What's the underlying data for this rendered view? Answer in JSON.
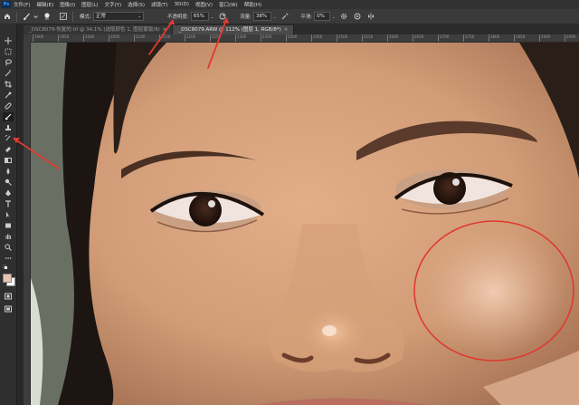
{
  "menubar": {
    "logo": "Ps",
    "items": [
      "文件(F)",
      "编辑(E)",
      "图像(I)",
      "图层(L)",
      "文字(Y)",
      "选择(S)",
      "滤镜(T)",
      "3D(D)",
      "视图(V)",
      "窗口(W)",
      "帮助(H)"
    ]
  },
  "options": {
    "brush_size": "60",
    "mode_label": "模式:",
    "mode_value": "正常",
    "opacity_label": "不透明度:",
    "opacity_value": "65%",
    "flow_label": "流量:",
    "flow_value": "38%",
    "smoothing_label": "平滑:",
    "smoothing_value": "0%"
  },
  "tabs": [
    {
      "label": "_DSC8079-恢复的.tif @ 34.1% (选取颜色 1, 图层蒙版/8)",
      "active": false
    },
    {
      "label": "_DSC8079.ARW @ 112% (图层 1, RGB/8*)",
      "active": true
    }
  ],
  "ruler": {
    "ticks": [
      "1900",
      "1950",
      "2000",
      "2050",
      "2100",
      "2150",
      "2200",
      "2250",
      "2300",
      "2350",
      "2400",
      "2450",
      "2500",
      "2550",
      "2600",
      "2650",
      "2700",
      "2750",
      "2800",
      "2850",
      "2900",
      "2950"
    ]
  },
  "colors": {
    "annotation": "#e03a2f",
    "foreground": "#e8c4b0",
    "background": "#ffffff"
  }
}
